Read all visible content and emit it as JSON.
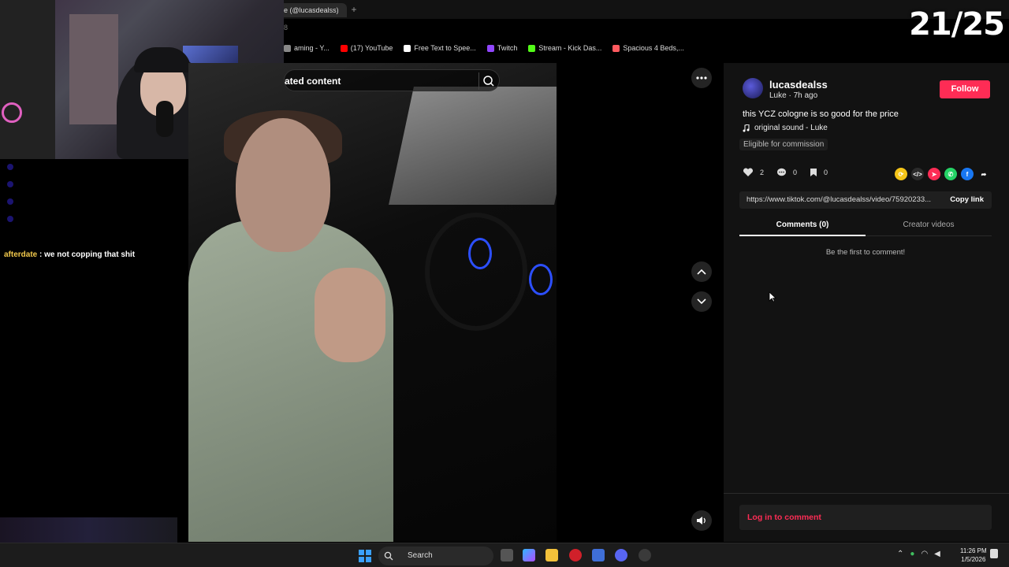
{
  "browser": {
    "tab_title": "e (@lucasdealss)",
    "tab_plus": "+",
    "address_fragment": "8",
    "bookmarks": [
      {
        "label": "aming - Y...",
        "color": "#888888"
      },
      {
        "label": "(17) YouTube",
        "color": "#ff0000"
      },
      {
        "label": "Free Text to Spee...",
        "color": "#ffffff"
      },
      {
        "label": "Twitch",
        "color": "#9146ff"
      },
      {
        "label": "Stream - Kick Das...",
        "color": "#53fc18"
      },
      {
        "label": "Spacious 4 Beds,...",
        "color": "#ff5a5f"
      }
    ]
  },
  "overlay": {
    "counter": "21/25"
  },
  "chat": {
    "user": "afterdate",
    "separator": " : ",
    "message": "we not copping that shit"
  },
  "video": {
    "search_text": "ated content"
  },
  "post": {
    "username": "lucasdealss",
    "meta": "Luke · 7h ago",
    "follow_label": "Follow",
    "caption": "this YCZ cologne is so good for the price",
    "sound": "original sound - Luke",
    "commission": "Eligible for commission",
    "likes": "2",
    "comments": "0",
    "saves": "0",
    "link_url": "https://www.tiktok.com/@lucasdealss/video/75920233...",
    "copy_link_label": "Copy link",
    "tab_comments": "Comments (0)",
    "tab_creator": "Creator videos",
    "empty_text": "Be the first to comment!",
    "login_label": "Log in to comment",
    "accent": "#fe2c55"
  },
  "taskbar": {
    "search_label": "Search",
    "time": "11:26 PM",
    "date": "1/5/2026"
  }
}
